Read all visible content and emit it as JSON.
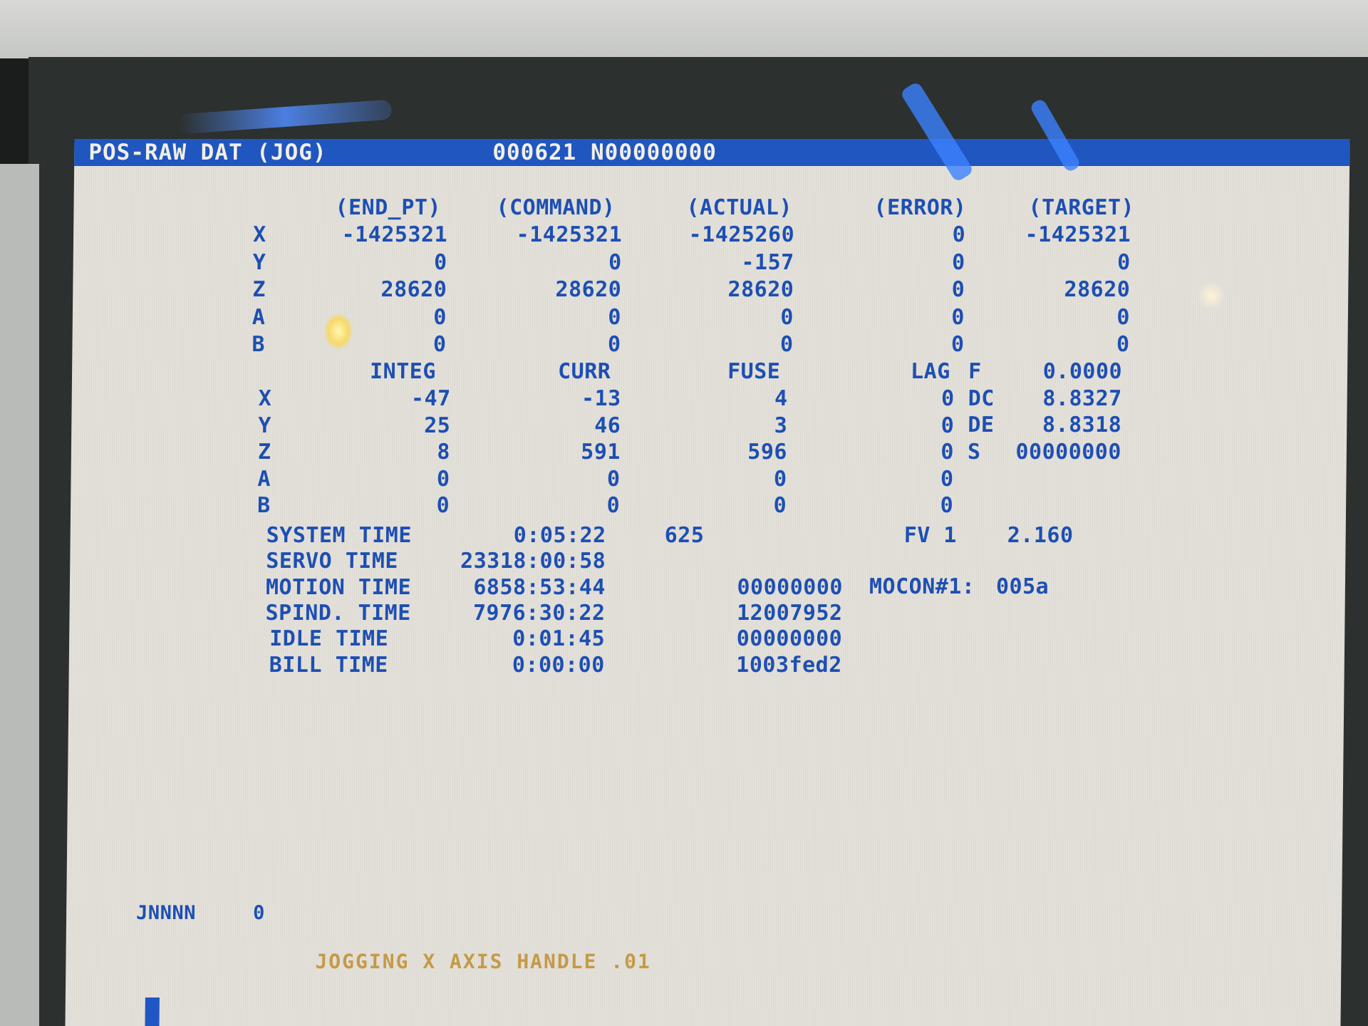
{
  "header": {
    "title": "POS-RAW DAT (JOG)",
    "program": "000621 N00000000"
  },
  "position_table": {
    "columns": [
      "(END_PT)",
      "(COMMAND)",
      "(ACTUAL)",
      "(ERROR)",
      "(TARGET)"
    ],
    "rows": [
      {
        "axis": "X",
        "values": [
          "-1425321",
          "-1425321",
          "-1425260",
          "0",
          "-1425321"
        ]
      },
      {
        "axis": "Y",
        "values": [
          "0",
          "0",
          "-157",
          "0",
          "0"
        ]
      },
      {
        "axis": "Z",
        "values": [
          "28620",
          "28620",
          "28620",
          "0",
          "28620"
        ]
      },
      {
        "axis": "A",
        "values": [
          "0",
          "0",
          "0",
          "0",
          "0"
        ]
      },
      {
        "axis": "B",
        "values": [
          "0",
          "0",
          "0",
          "0",
          "0"
        ]
      }
    ]
  },
  "servo_table": {
    "columns": [
      "INTEG",
      "CURR",
      "FUSE",
      "LAG"
    ],
    "rows": [
      {
        "axis": "X",
        "values": [
          "-47",
          "-13",
          "4",
          "0"
        ]
      },
      {
        "axis": "Y",
        "values": [
          "25",
          "46",
          "3",
          "0"
        ]
      },
      {
        "axis": "Z",
        "values": [
          "8",
          "591",
          "596",
          "0"
        ]
      },
      {
        "axis": "A",
        "values": [
          "0",
          "0",
          "0",
          "0"
        ]
      },
      {
        "axis": "B",
        "values": [
          "0",
          "0",
          "0",
          "0"
        ]
      }
    ],
    "side_values": [
      {
        "label": "F",
        "value": "0.0000"
      },
      {
        "label": "DC",
        "value": "8.8327"
      },
      {
        "label": "DE",
        "value": "8.8318"
      },
      {
        "label": "S",
        "value": "00000000"
      }
    ]
  },
  "times": [
    {
      "label": "SYSTEM TIME",
      "value": "0:05:22",
      "extra": "625"
    },
    {
      "label": "SERVO TIME",
      "value": "23318:00:58",
      "extra": ""
    },
    {
      "label": "MOTION TIME",
      "value": "6858:53:44",
      "extra": "00000000"
    },
    {
      "label": "SPIND. TIME",
      "value": "7976:30:22",
      "extra": "12007952"
    },
    {
      "label": "IDLE TIME",
      "value": "0:01:45",
      "extra": "00000000"
    },
    {
      "label": "BILL TIME",
      "value": "0:00:00",
      "extra": "1003fed2"
    }
  ],
  "firmware": {
    "label": "FV 1",
    "value": "2.160"
  },
  "mocon": {
    "label": "MOCON#1:",
    "value": "005a"
  },
  "input_line": {
    "label": "JNNNN",
    "value": "0"
  },
  "status_message": "JOGGING X AXIS HANDLE .01",
  "colors": {
    "header_bg": "#1f56c0",
    "text": "#1d4fb3",
    "status_text": "#c59a47",
    "screen_bg": "#e4e1da"
  }
}
